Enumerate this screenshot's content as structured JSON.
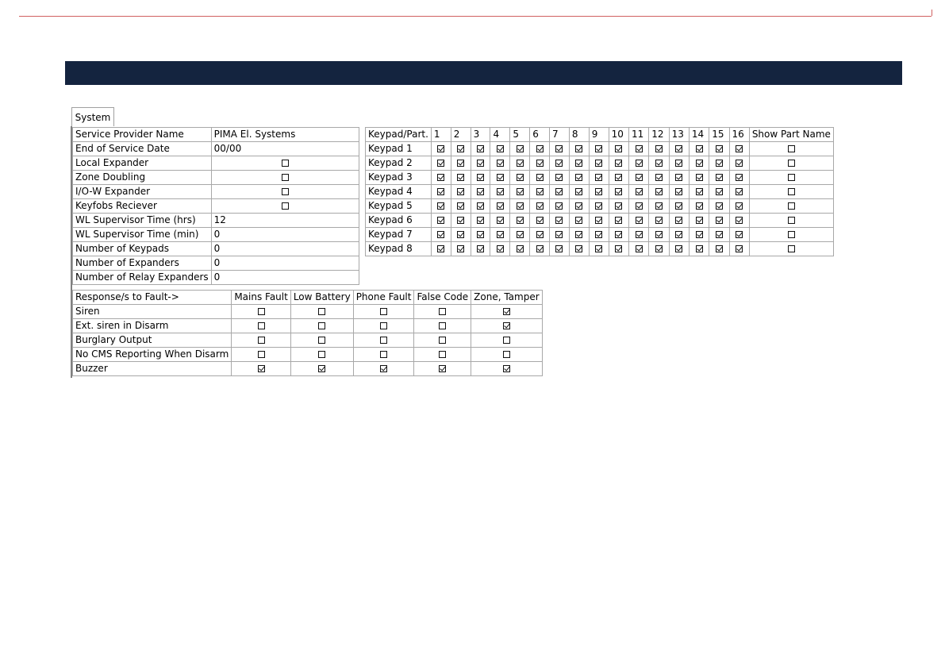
{
  "tabs": [
    "System"
  ],
  "system_settings": {
    "rows": [
      {
        "label": "Service Provider Name",
        "type": "text",
        "value": "PIMA El. Systems"
      },
      {
        "label": "End of Service Date",
        "type": "text",
        "value": "00/00"
      },
      {
        "label": "Local Expander",
        "type": "check",
        "checked": false
      },
      {
        "label": "Zone Doubling",
        "type": "check",
        "checked": false
      },
      {
        "label": "I/O-W Expander",
        "type": "check",
        "checked": false
      },
      {
        "label": "Keyfobs Reciever",
        "type": "check",
        "checked": false
      },
      {
        "label": "WL Supervisor Time (hrs)",
        "type": "text",
        "value": "12"
      },
      {
        "label": "WL Supervisor Time (min)",
        "type": "text",
        "value": "0"
      },
      {
        "label": "Number of Keypads",
        "type": "text",
        "value": "0"
      },
      {
        "label": "Number of Expanders",
        "type": "text",
        "value": "0"
      },
      {
        "label": "Number of Relay Expanders",
        "type": "text",
        "value": "0"
      }
    ]
  },
  "keypad_matrix": {
    "corner_header": "Keypad/Part.",
    "partition_headers": [
      "1",
      "2",
      "3",
      "4",
      "5",
      "6",
      "7",
      "8",
      "9",
      "10",
      "11",
      "12",
      "13",
      "14",
      "15",
      "16"
    ],
    "show_part_name_header": "Show Part Name",
    "rows": [
      {
        "label": "Keypad 1",
        "partitions": [
          true,
          true,
          true,
          true,
          true,
          true,
          true,
          true,
          true,
          true,
          true,
          true,
          true,
          true,
          true,
          true
        ],
        "show_part_name": false
      },
      {
        "label": "Keypad 2",
        "partitions": [
          true,
          true,
          true,
          true,
          true,
          true,
          true,
          true,
          true,
          true,
          true,
          true,
          true,
          true,
          true,
          true
        ],
        "show_part_name": false
      },
      {
        "label": "Keypad 3",
        "partitions": [
          true,
          true,
          true,
          true,
          true,
          true,
          true,
          true,
          true,
          true,
          true,
          true,
          true,
          true,
          true,
          true
        ],
        "show_part_name": false
      },
      {
        "label": "Keypad 4",
        "partitions": [
          true,
          true,
          true,
          true,
          true,
          true,
          true,
          true,
          true,
          true,
          true,
          true,
          true,
          true,
          true,
          true
        ],
        "show_part_name": false
      },
      {
        "label": "Keypad 5",
        "partitions": [
          true,
          true,
          true,
          true,
          true,
          true,
          true,
          true,
          true,
          true,
          true,
          true,
          true,
          true,
          true,
          true
        ],
        "show_part_name": false
      },
      {
        "label": "Keypad 6",
        "partitions": [
          true,
          true,
          true,
          true,
          true,
          true,
          true,
          true,
          true,
          true,
          true,
          true,
          true,
          true,
          true,
          true
        ],
        "show_part_name": false
      },
      {
        "label": "Keypad 7",
        "partitions": [
          true,
          true,
          true,
          true,
          true,
          true,
          true,
          true,
          true,
          true,
          true,
          true,
          true,
          true,
          true,
          true
        ],
        "show_part_name": false
      },
      {
        "label": "Keypad 8",
        "partitions": [
          true,
          true,
          true,
          true,
          true,
          true,
          true,
          true,
          true,
          true,
          true,
          true,
          true,
          true,
          true,
          true
        ],
        "show_part_name": false
      }
    ]
  },
  "fault_responses": {
    "corner_header": "Response/s to Fault->",
    "columns": [
      "Mains Fault",
      "Low Battery",
      "Phone Fault",
      "False Code",
      "Zone, Tamper"
    ],
    "rows": [
      {
        "label": "Siren",
        "values": [
          false,
          false,
          false,
          false,
          true
        ]
      },
      {
        "label": "Ext. siren in Disarm",
        "values": [
          false,
          false,
          false,
          false,
          true
        ]
      },
      {
        "label": "Burglary Output",
        "values": [
          false,
          false,
          false,
          false,
          false
        ]
      },
      {
        "label": "No CMS Reporting When Disarm",
        "values": [
          false,
          false,
          false,
          false,
          false
        ]
      },
      {
        "label": "Buzzer",
        "values": [
          true,
          true,
          true,
          true,
          true
        ]
      }
    ]
  },
  "colors": {
    "header_bar": "#14243f",
    "grid_border": "#a8a8a8"
  }
}
